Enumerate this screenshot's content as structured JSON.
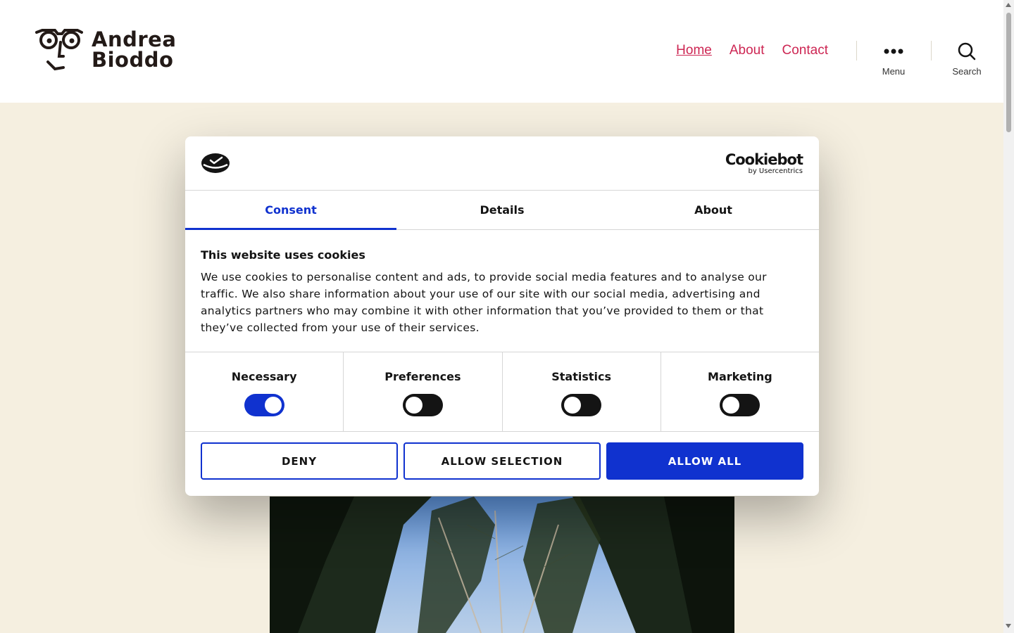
{
  "header": {
    "logo_line1": "Andrea",
    "logo_line2": "Bioddo",
    "nav": [
      {
        "label": "Home",
        "current": true
      },
      {
        "label": "About",
        "current": false
      },
      {
        "label": "Contact",
        "current": false
      }
    ],
    "menu_label": "Menu",
    "search_label": "Search",
    "link_color": "#cd2653"
  },
  "cookie_dialog": {
    "brand_name": "Cookiebot",
    "brand_sub": "by Usercentrics",
    "tabs": [
      {
        "label": "Consent",
        "active": true
      },
      {
        "label": "Details",
        "active": false
      },
      {
        "label": "About",
        "active": false
      }
    ],
    "heading": "This website uses cookies",
    "text": "We use cookies to personalise content and ads, to provide social media features and to analyse our traffic. We also share information about your use of our site with our social media, advertising and analytics partners who may combine it with other information that you’ve provided to them or that they’ve collected from your use of their services.",
    "categories": [
      {
        "label": "Necessary",
        "enabled": true
      },
      {
        "label": "Preferences",
        "enabled": false
      },
      {
        "label": "Statistics",
        "enabled": false
      },
      {
        "label": "Marketing",
        "enabled": false
      }
    ],
    "buttons": {
      "deny": "DENY",
      "allow_selection": "ALLOW SELECTION",
      "allow_all": "ALLOW ALL"
    },
    "accent_color": "#1032cf"
  },
  "colors": {
    "page_background": "#f5efe0"
  }
}
